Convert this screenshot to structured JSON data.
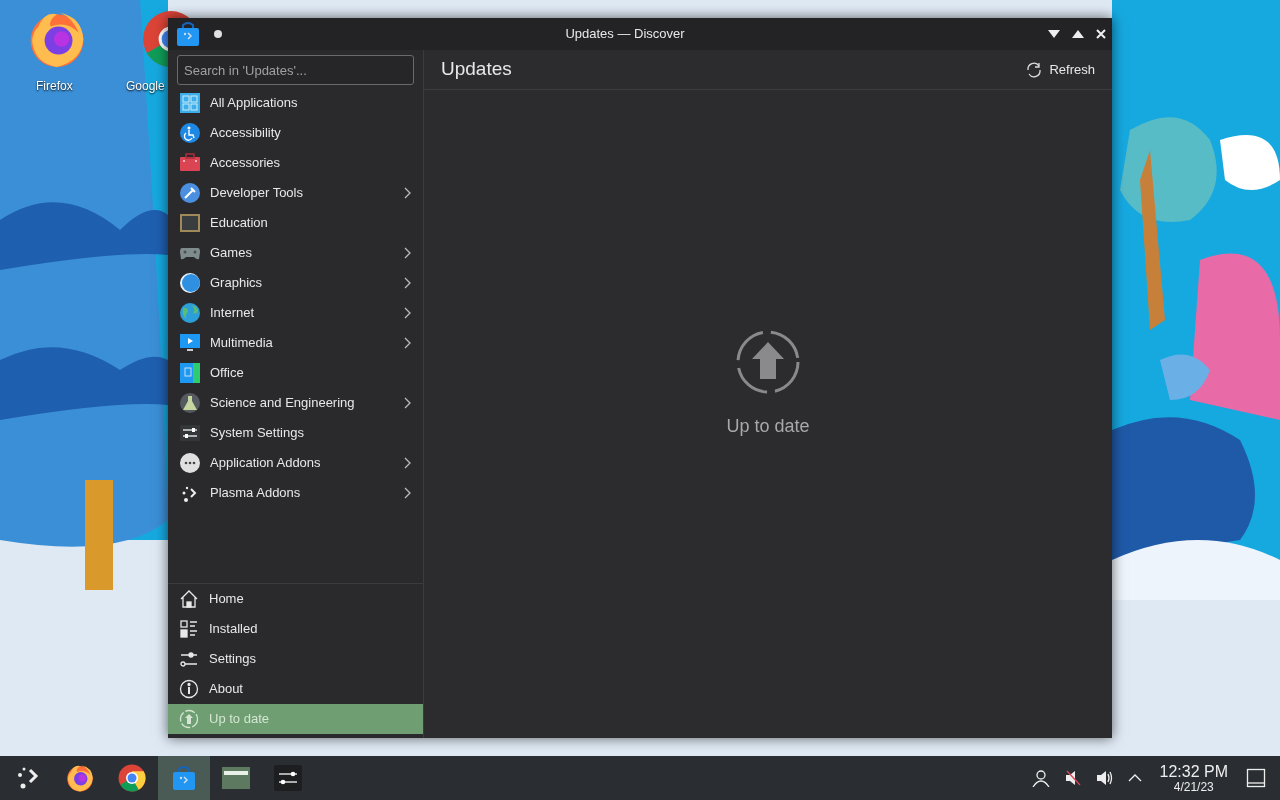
{
  "desktop_icons": [
    {
      "label": "Firefox",
      "kind": "firefox"
    },
    {
      "label": "Google",
      "kind": "chrome"
    }
  ],
  "window": {
    "title": "Updates — Discover"
  },
  "search": {
    "placeholder": "Search in 'Updates'..."
  },
  "categories": [
    {
      "label": "All Applications",
      "kind": "grid",
      "has_submenu": false
    },
    {
      "label": "Accessibility",
      "kind": "accessibility",
      "has_submenu": false
    },
    {
      "label": "Accessories",
      "kind": "toolbox",
      "has_submenu": false
    },
    {
      "label": "Developer Tools",
      "kind": "hammer",
      "has_submenu": true
    },
    {
      "label": "Education",
      "kind": "board",
      "has_submenu": false
    },
    {
      "label": "Games",
      "kind": "gamepad",
      "has_submenu": true
    },
    {
      "label": "Graphics",
      "kind": "sphere",
      "has_submenu": true
    },
    {
      "label": "Internet",
      "kind": "globe",
      "has_submenu": true
    },
    {
      "label": "Multimedia",
      "kind": "monitor",
      "has_submenu": true
    },
    {
      "label": "Office",
      "kind": "document",
      "has_submenu": false
    },
    {
      "label": "Science and Engineering",
      "kind": "flask",
      "has_submenu": true
    },
    {
      "label": "System Settings",
      "kind": "sliders",
      "has_submenu": false
    },
    {
      "label": "Application Addons",
      "kind": "dots",
      "has_submenu": true
    },
    {
      "label": "Plasma Addons",
      "kind": "plasma",
      "has_submenu": true
    }
  ],
  "navigation": [
    {
      "label": "Home",
      "kind": "home",
      "selected": false
    },
    {
      "label": "Installed",
      "kind": "installed",
      "selected": false
    },
    {
      "label": "Settings",
      "kind": "settings",
      "selected": false
    },
    {
      "label": "About",
      "kind": "about",
      "selected": false
    },
    {
      "label": "Up to date",
      "kind": "update",
      "selected": true
    }
  ],
  "page": {
    "title": "Updates",
    "refresh_label": "Refresh",
    "status": "Up to date"
  },
  "taskbar": {
    "tasks": [
      {
        "kind": "launcher",
        "selected": false
      },
      {
        "kind": "firefox",
        "selected": false
      },
      {
        "kind": "chrome",
        "selected": false
      },
      {
        "kind": "discover",
        "selected": true
      },
      {
        "kind": "files",
        "selected": false
      },
      {
        "kind": "settings",
        "selected": false
      }
    ],
    "time": "12:32 PM",
    "date": "4/21/23"
  }
}
